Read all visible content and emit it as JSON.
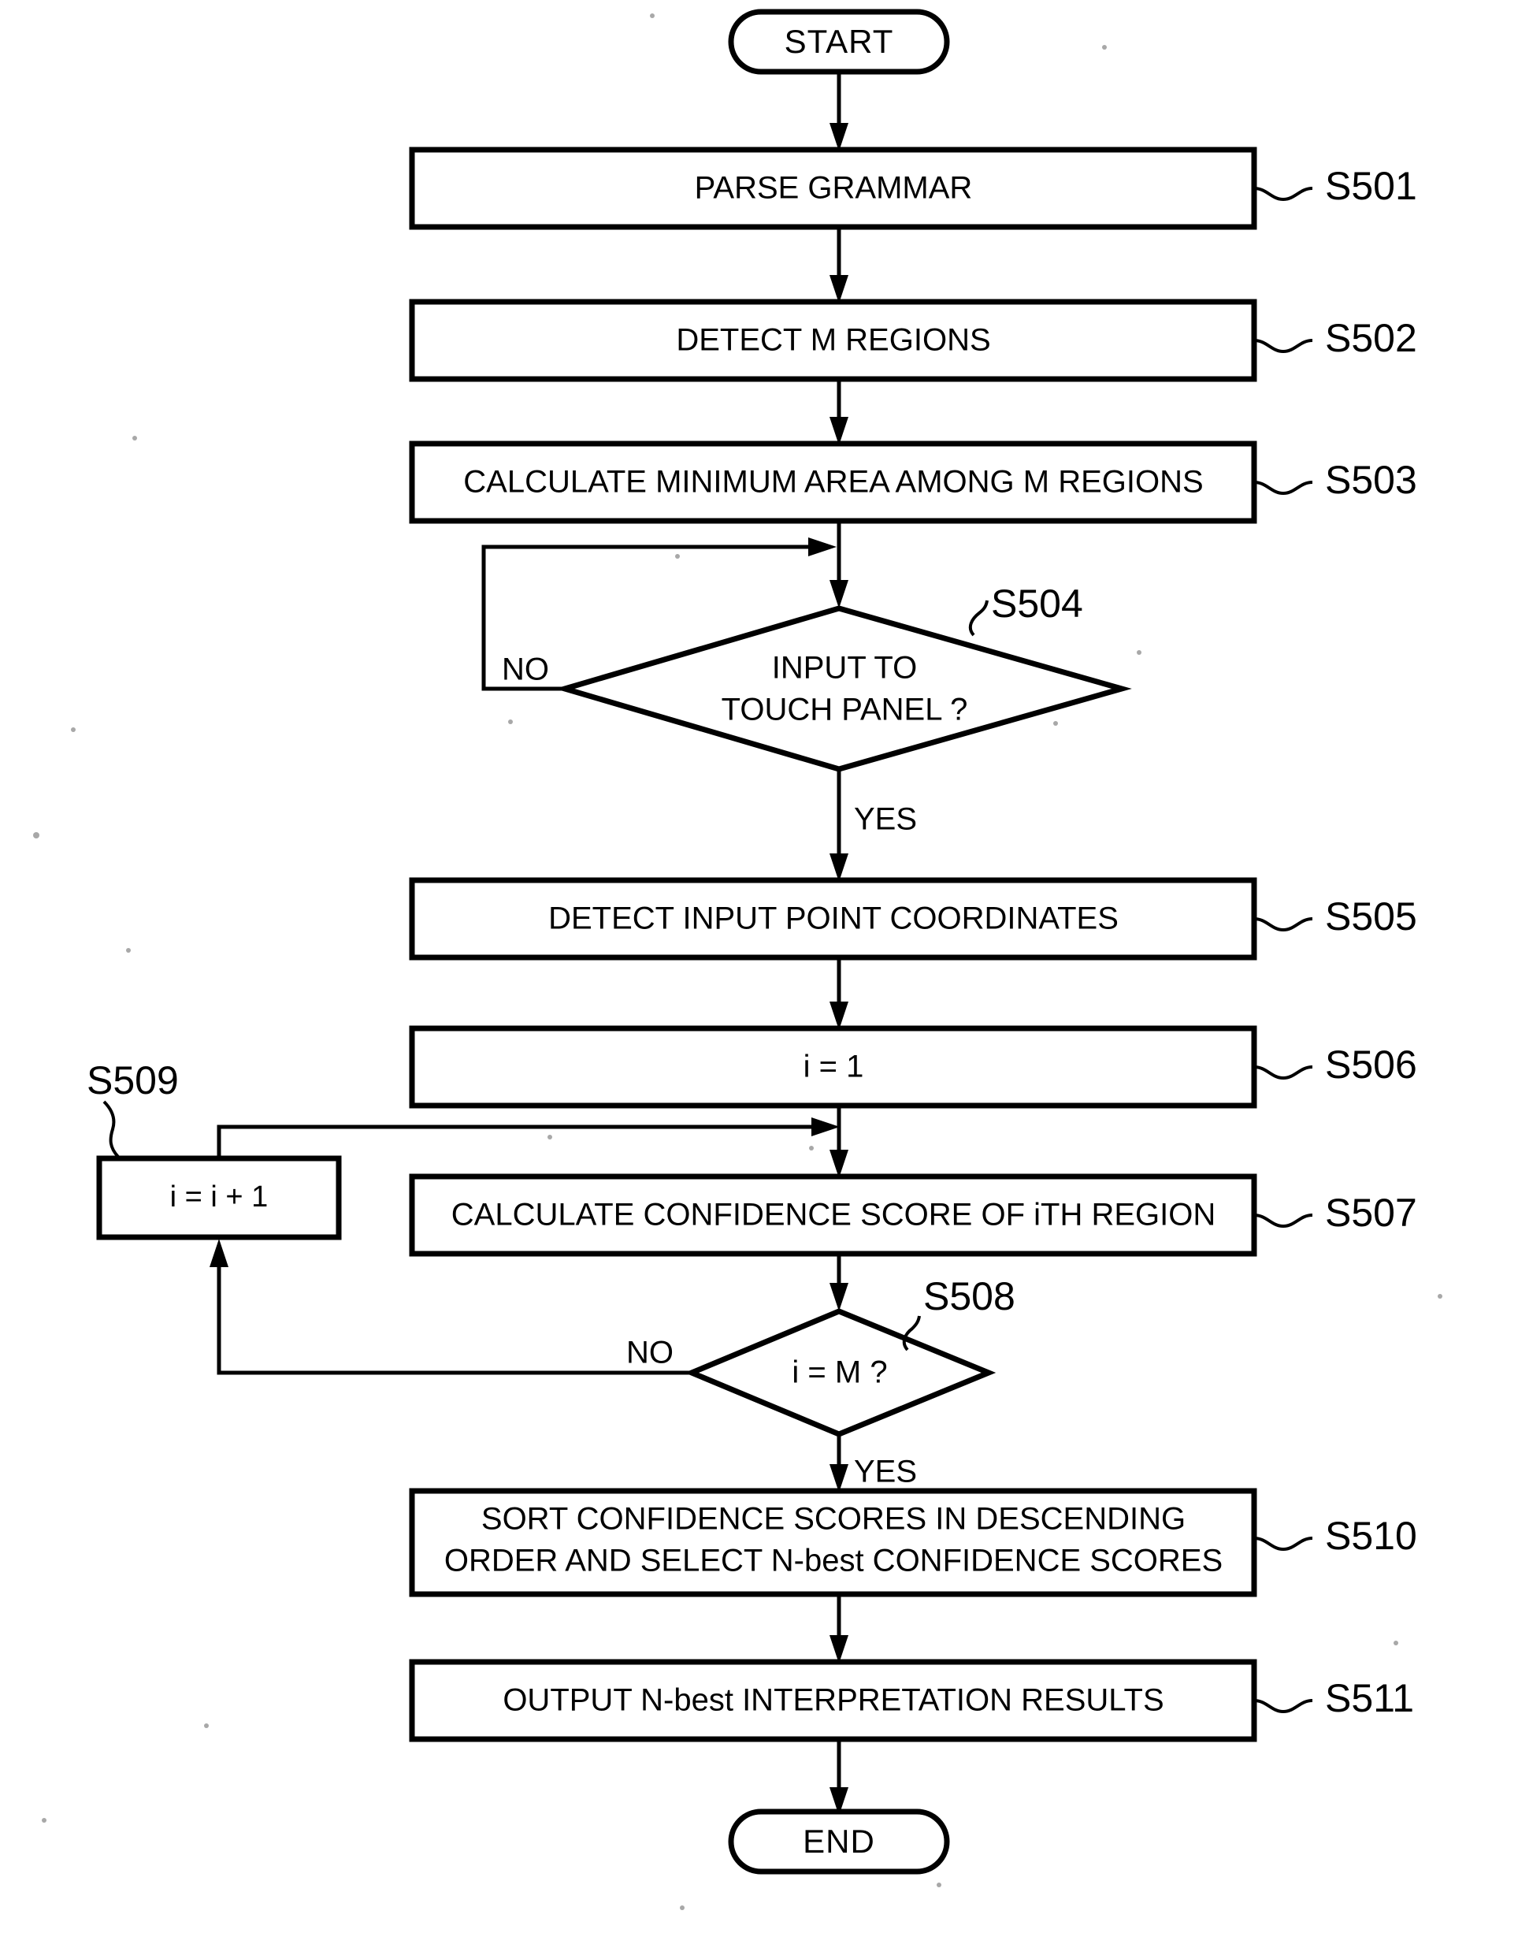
{
  "figure": {
    "type": "flowchart",
    "title": "",
    "terminators": {
      "start": "START",
      "end": "END"
    },
    "nodes": [
      {
        "id": "start",
        "kind": "terminator",
        "label": "START"
      },
      {
        "id": "s501",
        "kind": "process",
        "label": "PARSE GRAMMAR",
        "step": "S501"
      },
      {
        "id": "s502",
        "kind": "process",
        "label": "DETECT M REGIONS",
        "step": "S502"
      },
      {
        "id": "s503",
        "kind": "process",
        "label": "CALCULATE MINIMUM AREA AMONG M REGIONS",
        "step": "S503"
      },
      {
        "id": "s504",
        "kind": "decision",
        "label_line1": "INPUT TO",
        "label_line2": "TOUCH PANEL ?",
        "step": "S504"
      },
      {
        "id": "s505",
        "kind": "process",
        "label": "DETECT INPUT POINT COORDINATES",
        "step": "S505"
      },
      {
        "id": "s506",
        "kind": "process",
        "label": "i = 1",
        "step": "S506"
      },
      {
        "id": "s507",
        "kind": "process",
        "label": "CALCULATE CONFIDENCE SCORE OF iTH REGION",
        "step": "S507"
      },
      {
        "id": "s508",
        "kind": "decision",
        "label": "i = M ?",
        "step": "S508"
      },
      {
        "id": "s509",
        "kind": "process",
        "label": "i = i + 1",
        "step": "S509"
      },
      {
        "id": "s510",
        "kind": "process",
        "label_line1": "SORT CONFIDENCE SCORES IN DESCENDING",
        "label_line2": "ORDER AND SELECT N-best CONFIDENCE SCORES",
        "step": "S510"
      },
      {
        "id": "s511",
        "kind": "process",
        "label": "OUTPUT N-best INTERPRETATION RESULTS",
        "step": "S511"
      },
      {
        "id": "end",
        "kind": "terminator",
        "label": "END"
      }
    ],
    "branch_labels": {
      "s504_no": "NO",
      "s504_yes": "YES",
      "s508_no": "NO",
      "s508_yes": "YES"
    },
    "step_labels": {
      "s501": "S501",
      "s502": "S502",
      "s503": "S503",
      "s504": "S504",
      "s505": "S505",
      "s506": "S506",
      "s507": "S507",
      "s508": "S508",
      "s509": "S509",
      "s510": "S510",
      "s511": "S511"
    },
    "colors": {
      "stroke": "#000000",
      "fill": "#ffffff",
      "background": "#ffffff"
    }
  }
}
